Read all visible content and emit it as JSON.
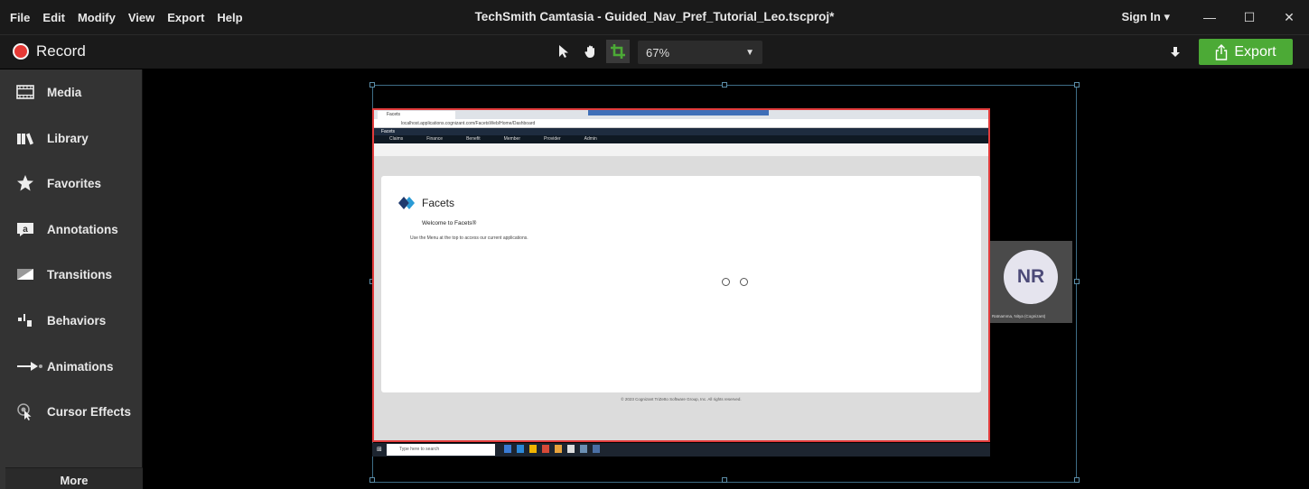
{
  "menu": [
    "File",
    "Edit",
    "Modify",
    "View",
    "Export",
    "Help"
  ],
  "window_title": "TechSmith Camtasia - Guided_Nav_Pref_Tutorial_Leo.tscproj*",
  "signin_label": "Sign In",
  "toolbar": {
    "record_label": "Record",
    "zoom_value": "67%",
    "export_label": "Export"
  },
  "sidebar": {
    "items": [
      {
        "label": "Media",
        "icon": "film-icon"
      },
      {
        "label": "Library",
        "icon": "library-icon"
      },
      {
        "label": "Favorites",
        "icon": "star-icon"
      },
      {
        "label": "Annotations",
        "icon": "annotation-icon"
      },
      {
        "label": "Transitions",
        "icon": "transition-icon"
      },
      {
        "label": "Behaviors",
        "icon": "behaviors-icon"
      },
      {
        "label": "Animations",
        "icon": "animation-icon"
      },
      {
        "label": "Cursor Effects",
        "icon": "cursor-effects-icon"
      }
    ],
    "more_label": "More"
  },
  "preview": {
    "browser_tab": "Facets",
    "address": "localhost.applications.cognizant.com/FacetsWeb/Home/Dashboard",
    "app_name": "Facets",
    "nav": [
      "Claims",
      "Finance",
      "Benefit",
      "Member",
      "Provider",
      "Admin"
    ],
    "logo_text": "Facets",
    "welcome": "Welcome to Facets®",
    "instruction": "Use the Menu at the top to access our current applications.",
    "copyright": "© 2023 Cognizant TriZetto Software Group, Inc. All rights reserved.",
    "taskbar_search": "Type here to search",
    "avatar_initials": "NR",
    "avatar_name": "Ratnamma, Nitya (Cognizant)"
  },
  "colors": {
    "export_green": "#4caa36",
    "record_red": "#e53935",
    "selection_border": "#e23c3c"
  }
}
